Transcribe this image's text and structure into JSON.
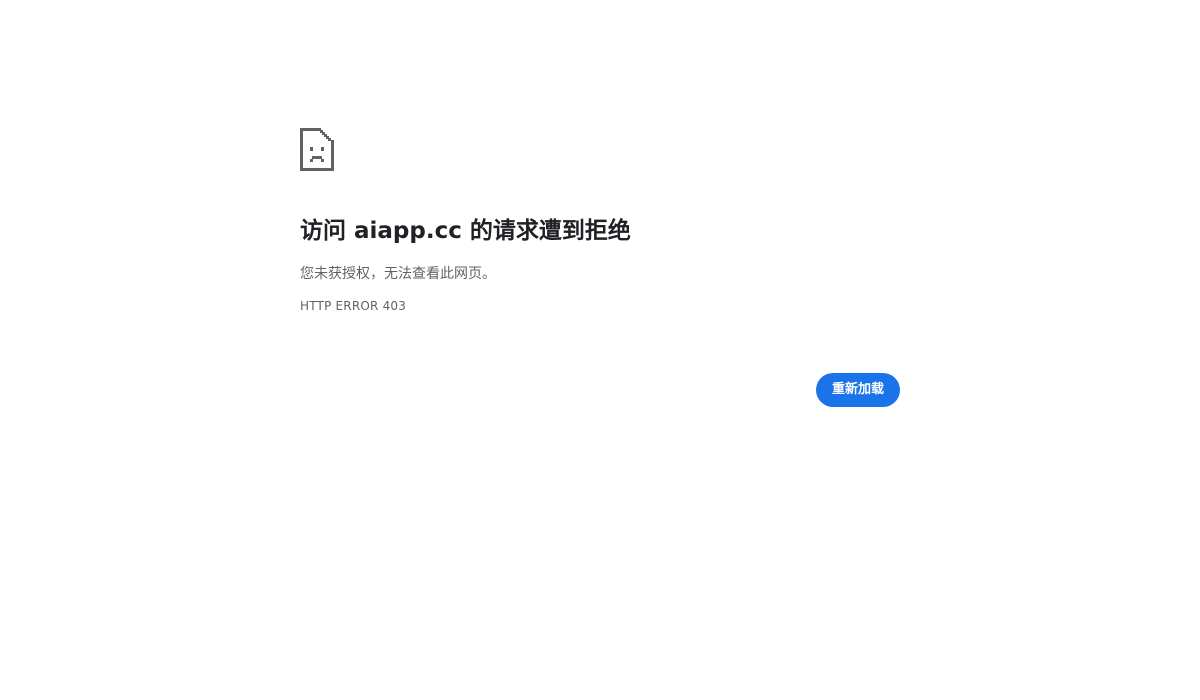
{
  "error_page": {
    "title": "访问 aiapp.cc 的请求遭到拒绝",
    "message": "您未获授权，无法查看此网页。",
    "error_code": "HTTP ERROR 403",
    "icon": "sad-document-icon",
    "reload_label": "重新加载"
  },
  "colors": {
    "background": "#ffffff",
    "title": "#202124",
    "secondary_text": "#5f6368",
    "button_accent": "#1a73e8",
    "button_text": "#ffffff"
  }
}
